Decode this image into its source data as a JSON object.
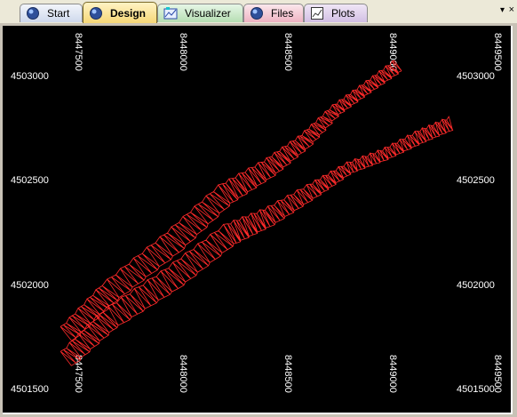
{
  "tabs": [
    {
      "label": "Start",
      "icon": "globe-icon",
      "active": false
    },
    {
      "label": "Design",
      "icon": "globe-icon",
      "active": true
    },
    {
      "label": "Visualizer",
      "icon": "visualizer-icon",
      "active": false
    },
    {
      "label": "Files",
      "icon": "globe-icon",
      "active": false
    },
    {
      "label": "Plots",
      "icon": "plot-icon",
      "active": false
    }
  ],
  "tab_menu_symbol": "▾",
  "close_symbol": "×",
  "colors": {
    "background": "#000000",
    "line": "#ff2a2a",
    "text": "#ffffff"
  },
  "plot": {
    "x_ticks": [
      "8447500",
      "8448000",
      "8448500",
      "8449000",
      "8449500"
    ],
    "x_ticks_bottom": [
      "8447500",
      "8448000",
      "8448500",
      "8449000",
      "8449500"
    ],
    "y_ticks_left": [
      "4503000",
      "4502500",
      "4502000",
      "4501500"
    ],
    "y_ticks_right": [
      "4503000",
      "4502500",
      "4502000",
      "4501500"
    ]
  }
}
